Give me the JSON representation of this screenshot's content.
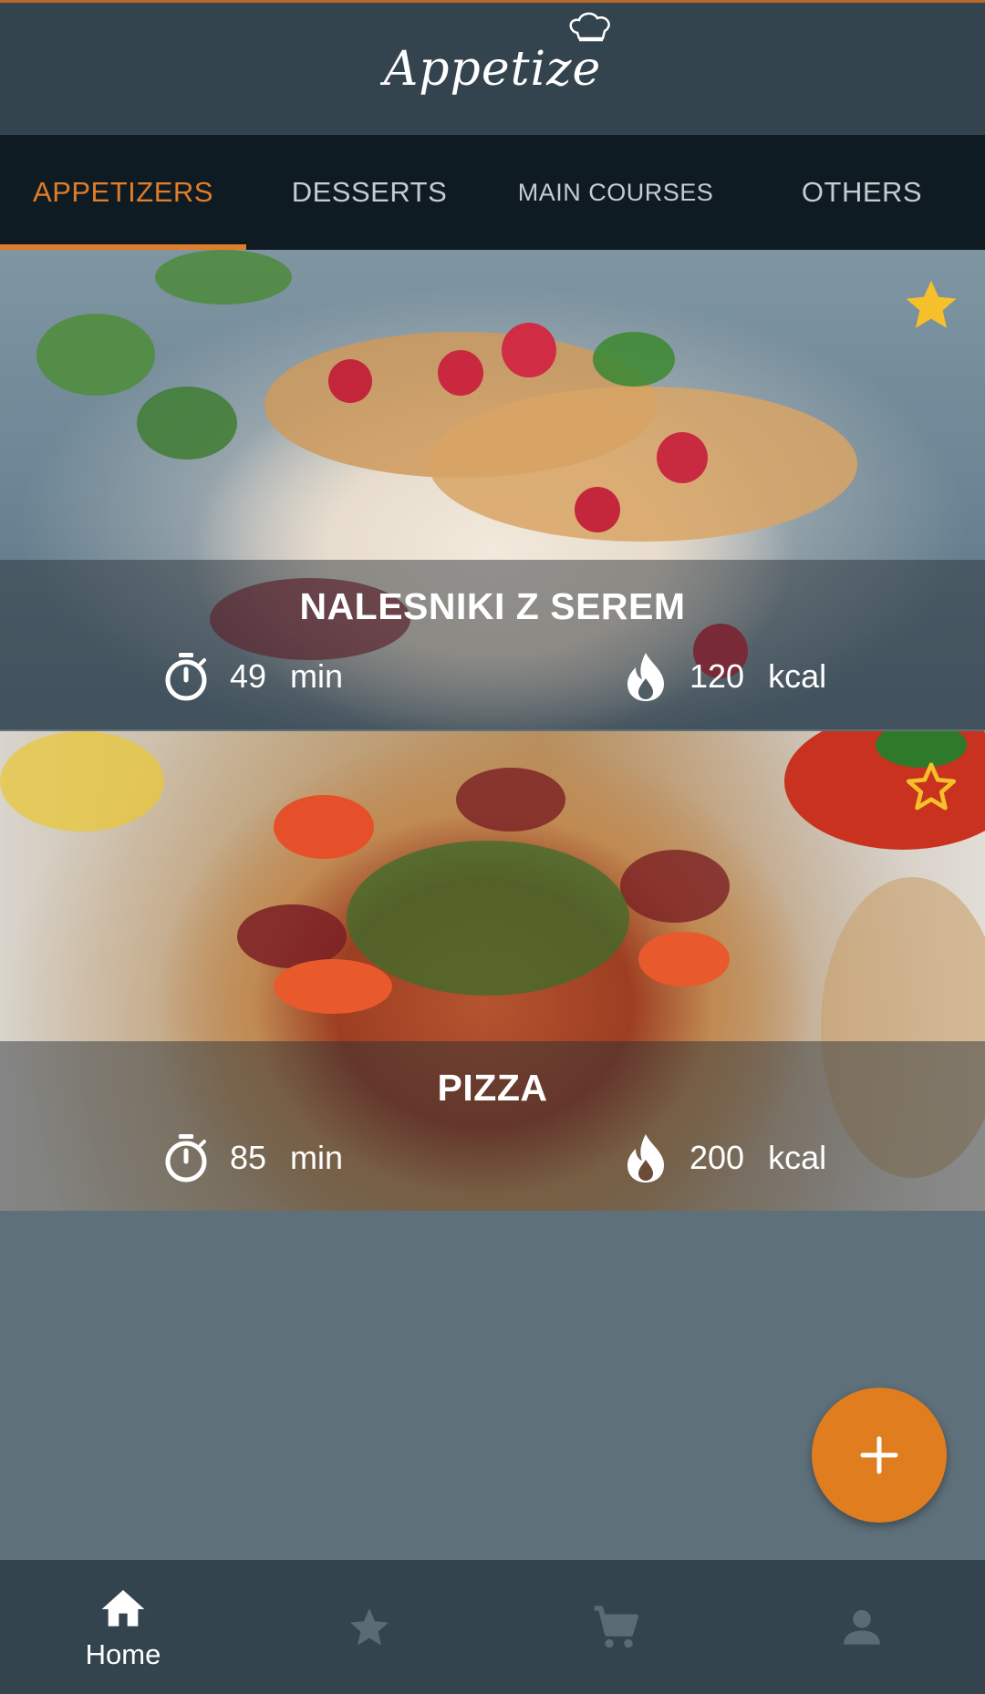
{
  "app": {
    "name": "Appetize"
  },
  "tabs": [
    {
      "label": "APPETIZERS",
      "active": true
    },
    {
      "label": "DESSERTS",
      "active": false
    },
    {
      "label": "MAIN COURSES",
      "active": false
    },
    {
      "label": "OTHERS",
      "active": false
    }
  ],
  "recipes": [
    {
      "name": "NALESNIKI Z SEREM",
      "time": "49",
      "time_unit": "min",
      "calories": "120",
      "calories_unit": "kcal",
      "favorite": true
    },
    {
      "name": "PIZZA",
      "time": "85",
      "time_unit": "min",
      "calories": "200",
      "calories_unit": "kcal",
      "favorite": false
    }
  ],
  "fab": {
    "icon": "plus-icon"
  },
  "bottom_nav": [
    {
      "icon": "home-icon",
      "label": "Home",
      "active": true
    },
    {
      "icon": "star-icon",
      "label": "",
      "active": false
    },
    {
      "icon": "cart-icon",
      "label": "",
      "active": false
    },
    {
      "icon": "person-icon",
      "label": "",
      "active": false
    }
  ],
  "colors": {
    "accent": "#e07d2a",
    "header_bg": "#34444e",
    "tabs_bg": "#0f1b22",
    "favorite_star": "#f6c02b",
    "content_bg": "#5e707a"
  }
}
